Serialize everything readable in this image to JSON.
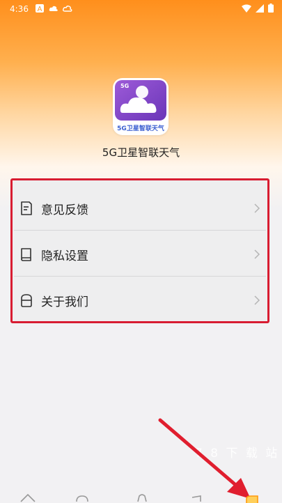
{
  "status_bar": {
    "time": "4:36",
    "left_icons": [
      "notification-a-icon",
      "cloud-icon",
      "weather-icon"
    ],
    "right_icons": [
      "wifi-icon",
      "signal-icon",
      "battery-icon"
    ]
  },
  "app": {
    "name": "5G卫星智联天气",
    "logo_badge": "5G",
    "logo_text": "5G卫星智联天气"
  },
  "menu": {
    "items": [
      {
        "label": "意见反馈",
        "icon": "feedback-icon"
      },
      {
        "label": "隐私设置",
        "icon": "privacy-book-icon"
      },
      {
        "label": "关于我们",
        "icon": "about-icon"
      }
    ]
  },
  "watermark": "7 8 下 载 站",
  "bottom_nav": {
    "icons": [
      "home-icon",
      "weather-icon",
      "alert-icon",
      "news-icon",
      "profile-icon"
    ],
    "active": 4
  },
  "colors": {
    "accent": "#ff8f1c",
    "highlight": "#d81c31",
    "logo_purple": "#8b4ccd"
  }
}
